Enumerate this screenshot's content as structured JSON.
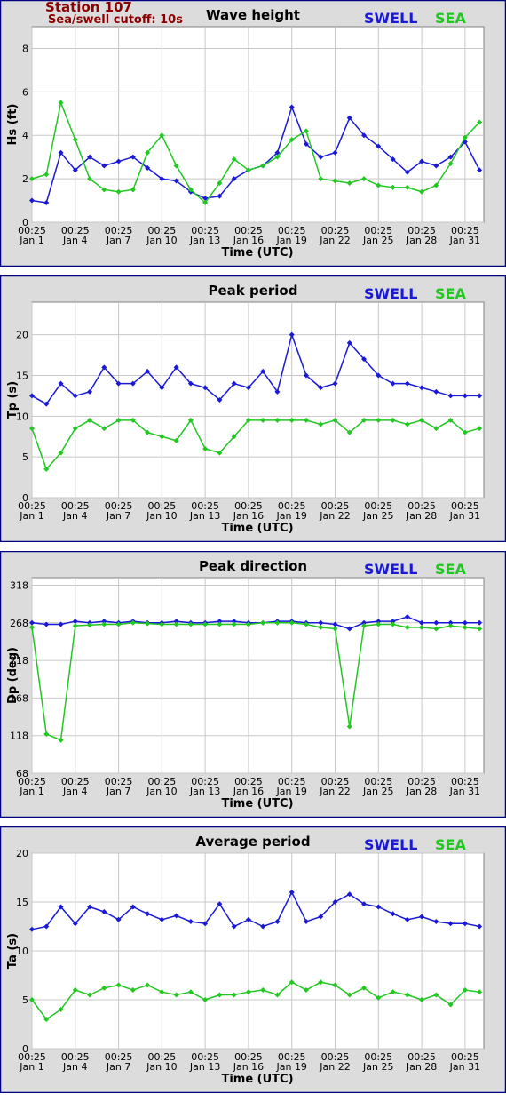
{
  "station": {
    "name": "Station 107",
    "cutoff": "Sea/swell cutoff: 10s"
  },
  "colors": {
    "swell": "#1a1ad6",
    "sea": "#22c722",
    "frame": "#000080",
    "background": "#dcdcdc",
    "station_text": "#8b0000"
  },
  "legend": {
    "swell": "SWELL",
    "sea": "SEA"
  },
  "x_axis": {
    "label": "Time (UTC)",
    "ticks": [
      {
        "day": 1,
        "top": "00:25",
        "bottom": "Jan 1"
      },
      {
        "day": 4,
        "top": "00:25",
        "bottom": "Jan 4"
      },
      {
        "day": 7,
        "top": "00:25",
        "bottom": "Jan 7"
      },
      {
        "day": 10,
        "top": "00:25",
        "bottom": "Jan 10"
      },
      {
        "day": 13,
        "top": "00:25",
        "bottom": "Jan 13"
      },
      {
        "day": 16,
        "top": "00:25",
        "bottom": "Jan 16"
      },
      {
        "day": 19,
        "top": "00:25",
        "bottom": "Jan 19"
      },
      {
        "day": 22,
        "top": "00:25",
        "bottom": "Jan 22"
      },
      {
        "day": 25,
        "top": "00:25",
        "bottom": "Jan 25"
      },
      {
        "day": 28,
        "top": "00:25",
        "bottom": "Jan 28"
      },
      {
        "day": 31,
        "top": "00:25",
        "bottom": "Jan 31"
      }
    ]
  },
  "chart_data": [
    {
      "type": "line",
      "title": "Wave height",
      "ylabel": "Hs (ft)",
      "xlabel": "Time (UTC)",
      "ylim": [
        0,
        9
      ],
      "yticks": [
        "0",
        "2",
        "4",
        "6",
        "8"
      ],
      "ytick_values": [
        0,
        2,
        4,
        6,
        8
      ],
      "grid": true,
      "x": [
        1,
        2,
        3,
        4,
        5,
        6,
        7,
        8,
        9,
        10,
        11,
        12,
        13,
        14,
        15,
        16,
        17,
        18,
        19,
        20,
        21,
        22,
        23,
        24,
        25,
        26,
        27,
        28,
        29,
        30,
        31,
        32
      ],
      "series": [
        {
          "name": "SWELL",
          "values": [
            1.0,
            0.9,
            3.2,
            2.4,
            3.0,
            2.6,
            2.8,
            3.0,
            2.5,
            2.0,
            1.9,
            1.4,
            1.1,
            1.2,
            2.0,
            2.4,
            2.6,
            3.2,
            5.3,
            3.6,
            3.0,
            3.2,
            4.8,
            4.0,
            3.5,
            2.9,
            2.3,
            2.8,
            2.6,
            3.0,
            3.7,
            2.4
          ]
        },
        {
          "name": "SEA",
          "values": [
            2.0,
            2.2,
            5.5,
            3.8,
            2.0,
            1.5,
            1.4,
            1.5,
            3.2,
            4.0,
            2.6,
            1.5,
            0.9,
            1.8,
            2.9,
            2.4,
            2.6,
            3.0,
            3.8,
            4.2,
            2.0,
            1.9,
            1.8,
            2.0,
            1.7,
            1.6,
            1.6,
            1.4,
            1.7,
            2.7,
            3.9,
            4.6
          ]
        }
      ]
    },
    {
      "type": "line",
      "title": "Peak period",
      "ylabel": "Tp (s)",
      "xlabel": "Time (UTC)",
      "ylim": [
        0,
        24
      ],
      "yticks": [
        "0",
        "5",
        "10",
        "15",
        "20"
      ],
      "ytick_values": [
        0,
        5,
        10,
        15,
        20
      ],
      "grid": true,
      "x": [
        1,
        2,
        3,
        4,
        5,
        6,
        7,
        8,
        9,
        10,
        11,
        12,
        13,
        14,
        15,
        16,
        17,
        18,
        19,
        20,
        21,
        22,
        23,
        24,
        25,
        26,
        27,
        28,
        29,
        30,
        31,
        32
      ],
      "series": [
        {
          "name": "SWELL",
          "values": [
            12.5,
            11.5,
            14.0,
            12.5,
            13.0,
            16.0,
            14.0,
            14.0,
            15.5,
            13.5,
            16.0,
            14.0,
            13.5,
            12.0,
            14.0,
            13.5,
            15.5,
            13.0,
            20.0,
            15.0,
            13.5,
            14.0,
            19.0,
            17.0,
            15.0,
            14.0,
            14.0,
            13.5,
            13.0,
            12.5,
            12.5,
            12.5
          ]
        },
        {
          "name": "SEA",
          "values": [
            8.5,
            3.5,
            5.5,
            8.5,
            9.5,
            8.5,
            9.5,
            9.5,
            8.0,
            7.5,
            7.0,
            9.5,
            6.0,
            5.5,
            7.5,
            9.5,
            9.5,
            9.5,
            9.5,
            9.5,
            9.0,
            9.5,
            8.0,
            9.5,
            9.5,
            9.5,
            9.0,
            9.5,
            8.5,
            9.5,
            8.0,
            8.5
          ]
        }
      ]
    },
    {
      "type": "line",
      "title": "Peak direction",
      "ylabel": "Dp (deg)",
      "xlabel": "Time (UTC)",
      "ylim": [
        68,
        328
      ],
      "yticks": [
        "68",
        "118",
        "168",
        "218",
        "268",
        "318"
      ],
      "ytick_values": [
        68,
        118,
        168,
        218,
        268,
        318
      ],
      "grid": true,
      "x": [
        1,
        2,
        3,
        4,
        5,
        6,
        7,
        8,
        9,
        10,
        11,
        12,
        13,
        14,
        15,
        16,
        17,
        18,
        19,
        20,
        21,
        22,
        23,
        24,
        25,
        26,
        27,
        28,
        29,
        30,
        31,
        32
      ],
      "series": [
        {
          "name": "SWELL",
          "values": [
            268,
            266,
            266,
            270,
            268,
            270,
            268,
            270,
            268,
            268,
            270,
            268,
            268,
            270,
            270,
            268,
            268,
            270,
            270,
            268,
            268,
            266,
            260,
            268,
            270,
            270,
            276,
            268,
            268,
            268,
            268,
            268
          ]
        },
        {
          "name": "SEA",
          "values": [
            262,
            120,
            112,
            264,
            265,
            266,
            266,
            268,
            267,
            266,
            266,
            266,
            266,
            266,
            266,
            266,
            268,
            268,
            268,
            266,
            262,
            260,
            130,
            264,
            266,
            266,
            262,
            262,
            260,
            264,
            262,
            260
          ]
        }
      ]
    },
    {
      "type": "line",
      "title": "Average period",
      "ylabel": "Ta (s)",
      "xlabel": "Time (UTC)",
      "ylim": [
        0,
        20
      ],
      "yticks": [
        "0",
        "5",
        "10",
        "15",
        "20"
      ],
      "ytick_values": [
        0,
        5,
        10,
        15,
        20
      ],
      "grid": true,
      "x": [
        1,
        2,
        3,
        4,
        5,
        6,
        7,
        8,
        9,
        10,
        11,
        12,
        13,
        14,
        15,
        16,
        17,
        18,
        19,
        20,
        21,
        22,
        23,
        24,
        25,
        26,
        27,
        28,
        29,
        30,
        31,
        32
      ],
      "series": [
        {
          "name": "SWELL",
          "values": [
            12.2,
            12.5,
            14.5,
            12.8,
            14.5,
            14.0,
            13.2,
            14.5,
            13.8,
            13.2,
            13.6,
            13.0,
            12.8,
            14.8,
            12.5,
            13.2,
            12.5,
            13.0,
            16.0,
            13.0,
            13.5,
            15.0,
            15.8,
            14.8,
            14.5,
            13.8,
            13.2,
            13.5,
            13.0,
            12.8,
            12.8,
            12.5
          ]
        },
        {
          "name": "SEA",
          "values": [
            5.0,
            3.0,
            4.0,
            6.0,
            5.5,
            6.2,
            6.5,
            6.0,
            6.5,
            5.8,
            5.5,
            5.8,
            5.0,
            5.5,
            5.5,
            5.8,
            6.0,
            5.5,
            6.8,
            6.0,
            6.8,
            6.5,
            5.5,
            6.2,
            5.2,
            5.8,
            5.5,
            5.0,
            5.5,
            4.5,
            6.0,
            5.8
          ]
        }
      ]
    }
  ]
}
